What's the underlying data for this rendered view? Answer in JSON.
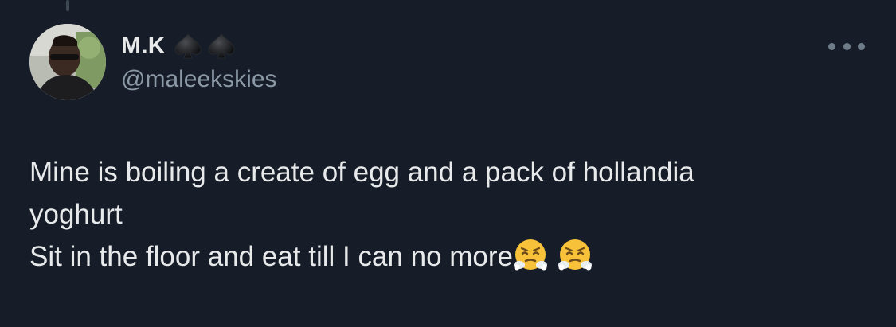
{
  "tweet": {
    "author": {
      "display_name": "M.K",
      "name_emojis": [
        "spade-icon",
        "spade-icon"
      ],
      "handle": "@maleekskies",
      "avatar": "profile-photo"
    },
    "text_lines": [
      "Mine is boiling a create of egg and a pack of hollandia",
      "yoghurt",
      "Sit in the floor and eat till I can no more"
    ],
    "text_emojis": [
      "face-with-steam-icon",
      "face-with-steam-icon"
    ],
    "more_menu_icon": "more-dots-icon"
  },
  "colors": {
    "background": "#161d28",
    "text_primary": "#e7e9ea",
    "text_secondary": "#8b98a5"
  }
}
